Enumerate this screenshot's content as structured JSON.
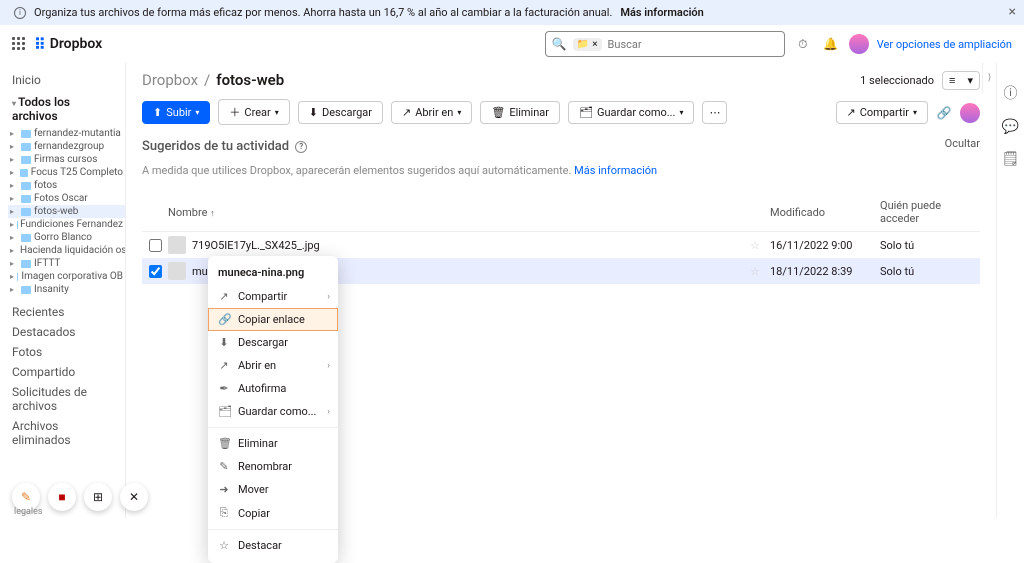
{
  "banner": {
    "text": "Organiza tus archivos de forma más eficaz por menos. Ahorra hasta un 16,7 % al año al cambiar a la facturación anual.",
    "cta": "Más información"
  },
  "brand": "Dropbox",
  "search": {
    "placeholder": "Buscar",
    "chip_icon": "folder"
  },
  "top_link": "Ver opciones de ampliación",
  "sidebar": {
    "home": "Inicio",
    "all_files": "Todos los archivos",
    "tree": [
      {
        "label": "fernandez-mutantia"
      },
      {
        "label": "fernandezgroup"
      },
      {
        "label": "Firmas cursos"
      },
      {
        "label": "Focus T25 Completo"
      },
      {
        "label": "fotos"
      },
      {
        "label": "Fotos Oscar"
      },
      {
        "label": "fotos-web",
        "selected": true
      },
      {
        "label": "Fundiciones Fernandez"
      },
      {
        "label": "Gorro Blanco"
      },
      {
        "label": "Hacienda liquidación oscar..."
      },
      {
        "label": "IFTTT"
      },
      {
        "label": "Imagen corporativa OB"
      },
      {
        "label": "Insanity"
      }
    ],
    "nav": [
      "Recientes",
      "Destacados",
      "Fotos",
      "Compartido",
      "Solicitudes de archivos",
      "Archivos eliminados"
    ]
  },
  "breadcrumb": {
    "root": "Dropbox",
    "sep": "/",
    "current": "fotos-web"
  },
  "selection": {
    "count_label": "1 seleccionado"
  },
  "toolbar": {
    "upload": "Subir",
    "create": "Crear",
    "download": "Descargar",
    "open_in": "Abrir en",
    "delete": "Eliminar",
    "save_as": "Guardar como...",
    "share": "Compartir"
  },
  "suggested": {
    "title": "Sugeridos de tu actividad",
    "hide": "Ocultar",
    "hint_pre": "A medida que utilices Dropbox, aparecerán elementos sugeridos aquí automáticamente.",
    "hint_link": "Más información"
  },
  "table": {
    "cols": {
      "name": "Nombre",
      "modified": "Modificado",
      "access": "Quién puede acceder"
    },
    "rows": [
      {
        "name": "719O5IE17yL._SX425_.jpg",
        "modified": "16/11/2022 9:00",
        "access": "Solo tú",
        "selected": false
      },
      {
        "name": "muneca-nina.png",
        "modified": "18/11/2022 8:39",
        "access": "Solo tú",
        "selected": true
      }
    ]
  },
  "context_menu": {
    "title": "muneca-nina.png",
    "group1": [
      {
        "label": "Compartir",
        "icon": "share",
        "sub": true
      },
      {
        "label": "Copiar enlace",
        "icon": "link",
        "highlight": true
      },
      {
        "label": "Descargar",
        "icon": "download"
      },
      {
        "label": "Abrir en",
        "icon": "open",
        "sub": true
      },
      {
        "label": "Autofirma",
        "icon": "sign"
      },
      {
        "label": "Guardar como...",
        "icon": "saveas",
        "sub": true
      }
    ],
    "group2": [
      {
        "label": "Eliminar",
        "icon": "trash"
      },
      {
        "label": "Renombrar",
        "icon": "rename"
      },
      {
        "label": "Mover",
        "icon": "move"
      },
      {
        "label": "Copiar",
        "icon": "copy"
      }
    ],
    "group3": [
      {
        "label": "Destacar",
        "icon": "star"
      }
    ]
  },
  "legal": "legales"
}
